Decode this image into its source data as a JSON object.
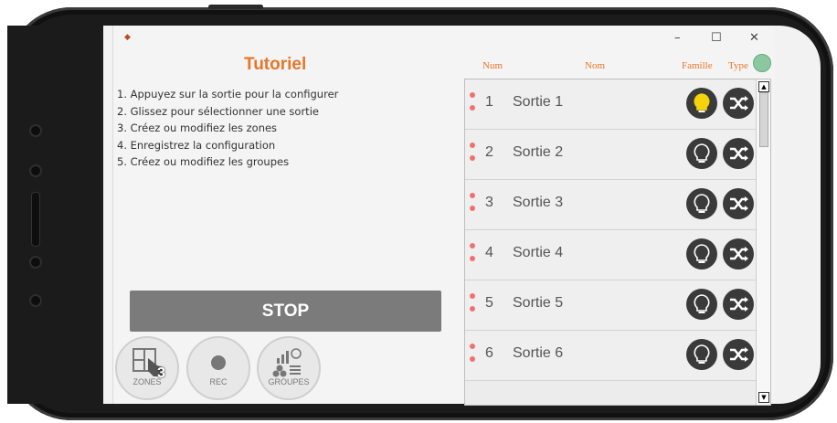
{
  "app": {
    "title": "Tutoriel",
    "window_controls": {
      "minimize": "–",
      "maximize": "☐",
      "close": "✕"
    }
  },
  "steps": [
    "1. Appuyez sur la sortie pour la configurer",
    "2. Glissez pour sélectionner une sortie",
    "3. Créez ou modifiez les zones",
    "4. Enregistrez la configuration",
    "5. Créez ou modifiez les groupes"
  ],
  "columns": {
    "num": "Num",
    "nom": "Nom",
    "famille": "Famille",
    "type": "Type"
  },
  "outputs": [
    {
      "num": "1",
      "name": "Sortie 1",
      "famille_icon": "lightbulb-active-icon",
      "type_icon": "shuffle-icon"
    },
    {
      "num": "2",
      "name": "Sortie 2",
      "famille_icon": "lightbulb-icon",
      "type_icon": "shuffle-icon"
    },
    {
      "num": "3",
      "name": "Sortie 3",
      "famille_icon": "lightbulb-icon",
      "type_icon": "shuffle-icon"
    },
    {
      "num": "4",
      "name": "Sortie 4",
      "famille_icon": "lightbulb-icon",
      "type_icon": "shuffle-icon"
    },
    {
      "num": "5",
      "name": "Sortie 5",
      "famille_icon": "lightbulb-icon",
      "type_icon": "shuffle-icon"
    },
    {
      "num": "6",
      "name": "Sortie 6",
      "famille_icon": "lightbulb-icon",
      "type_icon": "shuffle-icon"
    }
  ],
  "buttons": {
    "stop": "STOP",
    "zones": "ZONES",
    "zones_badge": "3",
    "rec": "REC",
    "groupes": "GROUPES"
  },
  "colors": {
    "accent": "#e8752a",
    "active_bulb": "#f5d20a",
    "dot": "#f07070",
    "stop_bg": "#7b7b7b"
  }
}
